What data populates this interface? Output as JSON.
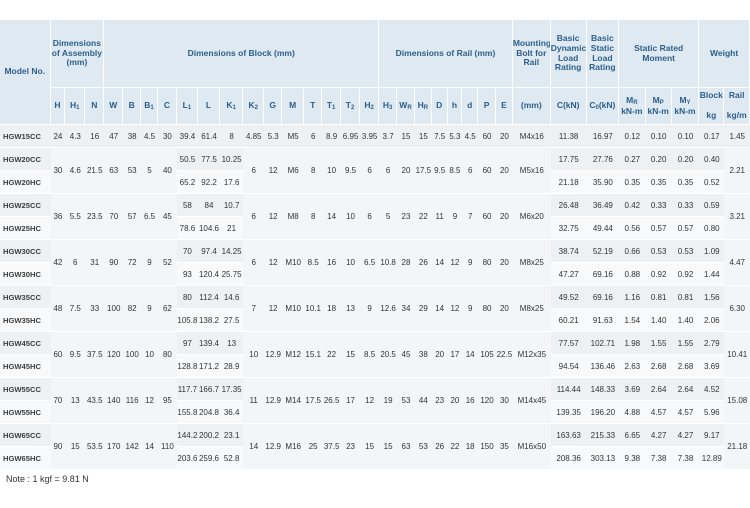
{
  "header": {
    "model_no": "Model No.",
    "dim_assembly": "Dimensions of Assembly (mm)",
    "dim_block": "Dimensions of Block (mm)",
    "dim_rail": "Dimensions of Rail (mm)",
    "mounting_bolt": "Mounting Bolt for Rail",
    "basic_dynamic": "Basic Dynamic Load Rating",
    "basic_static": "Basic Static Load Rating",
    "static_moment": "Static Rated Moment",
    "weight": "Weight",
    "block": "Block",
    "rail": "Rail",
    "sub": {
      "H": "H",
      "H1": "H₁",
      "N": "N",
      "W": "W",
      "B": "B",
      "B1": "B₁",
      "C": "C",
      "L1": "L₁",
      "L": "L",
      "K1": "K₁",
      "K2": "K₂",
      "G": "G",
      "M": "M",
      "T": "T",
      "T1": "T₁",
      "T2": "T₂",
      "H2": "H₂",
      "H3": "H₃",
      "WR": "W_R",
      "HR": "H_R",
      "D": "D",
      "h": "h",
      "d": "d",
      "P": "P",
      "E": "E",
      "mm": "(mm)",
      "C_kN": "C(kN)",
      "C0_kN": "C₀(kN)",
      "MR": "M_R",
      "MP": "M_P",
      "MY": "M_Y",
      "kNm1": "kN-m",
      "kNm2": "kN-m",
      "kNm3": "kN-m",
      "kg": "kg",
      "kgm": "kg/m"
    }
  },
  "groups": [
    {
      "rows": [
        {
          "model": "HGW15CC",
          "L1": "39.4",
          "L": "61.4",
          "K1": "8",
          "K2": "4.85",
          "C_kN": "11.38",
          "C0_kN": "16.97",
          "MR": "0.12",
          "MP": "0.10",
          "MY": "0.10",
          "kg": "0.17"
        }
      ],
      "shared": {
        "H": "24",
        "H1": "4.3",
        "N": "16",
        "W": "47",
        "B": "38",
        "B1": "4.5",
        "C": "30",
        "G": "5.3",
        "M": "M5",
        "T": "6",
        "T1": "8.9",
        "T2": "6.95",
        "H2": "3.95",
        "H3": "3.7",
        "WR": "15",
        "HR": "15",
        "D": "7.5",
        "h": "5.3",
        "d": "4.5",
        "P": "60",
        "E": "20",
        "bolt": "M4x16",
        "kgm": "1.45"
      }
    },
    {
      "rows": [
        {
          "model": "HGW20CC",
          "L1": "50.5",
          "L": "77.5",
          "K1": "10.25",
          "C_kN": "17.75",
          "C0_kN": "27.76",
          "MR": "0.27",
          "MP": "0.20",
          "MY": "0.20",
          "kg": "0.40"
        },
        {
          "model": "HGW20HC",
          "L1": "65.2",
          "L": "92.2",
          "K1": "17.6",
          "C_kN": "21.18",
          "C0_kN": "35.90",
          "MR": "0.35",
          "MP": "0.35",
          "MY": "0.35",
          "kg": "0.52"
        }
      ],
      "shared": {
        "H": "30",
        "H1": "4.6",
        "N": "21.5",
        "W": "63",
        "B": "53",
        "B1": "5",
        "C": "40",
        "K2": "6",
        "G": "12",
        "M": "M6",
        "T": "8",
        "T1": "10",
        "T2": "9.5",
        "H2": "6",
        "H3": "6",
        "WR": "20",
        "HR": "17.5",
        "D": "9.5",
        "h": "8.5",
        "d": "6",
        "P": "60",
        "E": "20",
        "bolt": "M5x16",
        "kgm": "2.21"
      }
    },
    {
      "rows": [
        {
          "model": "HGW25CC",
          "L1": "58",
          "L": "84",
          "K1": "10.7",
          "C_kN": "26.48",
          "C0_kN": "36.49",
          "MR": "0.42",
          "MP": "0.33",
          "MY": "0.33",
          "kg": "0.59"
        },
        {
          "model": "HGW25HC",
          "L1": "78.6",
          "L": "104.6",
          "K1": "21",
          "C_kN": "32.75",
          "C0_kN": "49.44",
          "MR": "0.56",
          "MP": "0.57",
          "MY": "0.57",
          "kg": "0.80"
        }
      ],
      "shared": {
        "H": "36",
        "H1": "5.5",
        "N": "23.5",
        "W": "70",
        "B": "57",
        "B1": "6.5",
        "C": "45",
        "K2": "6",
        "G": "12",
        "M": "M8",
        "T": "8",
        "T1": "14",
        "T2": "10",
        "H2": "6",
        "H3": "5",
        "WR": "23",
        "HR": "22",
        "D": "11",
        "h": "9",
        "d": "7",
        "P": "60",
        "E": "20",
        "bolt": "M6x20",
        "kgm": "3.21"
      }
    },
    {
      "rows": [
        {
          "model": "HGW30CC",
          "L1": "70",
          "L": "97.4",
          "K1": "14.25",
          "C_kN": "38.74",
          "C0_kN": "52.19",
          "MR": "0.66",
          "MP": "0.53",
          "MY": "0.53",
          "kg": "1.09"
        },
        {
          "model": "HGW30HC",
          "L1": "93",
          "L": "120.4",
          "K1": "25.75",
          "C_kN": "47.27",
          "C0_kN": "69.16",
          "MR": "0.88",
          "MP": "0.92",
          "MY": "0.92",
          "kg": "1.44"
        }
      ],
      "shared": {
        "H": "42",
        "H1": "6",
        "N": "31",
        "W": "90",
        "B": "72",
        "B1": "9",
        "C": "52",
        "K2": "6",
        "G": "12",
        "M": "M10",
        "T": "8.5",
        "T1": "16",
        "T2": "10",
        "H2": "6.5",
        "H3": "10.8",
        "WR": "28",
        "HR": "26",
        "D": "14",
        "h": "12",
        "d": "9",
        "P": "80",
        "E": "20",
        "bolt": "M8x25",
        "kgm": "4.47"
      }
    },
    {
      "rows": [
        {
          "model": "HGW35CC",
          "L1": "80",
          "L": "112.4",
          "K1": "14.6",
          "C_kN": "49.52",
          "C0_kN": "69.16",
          "MR": "1.16",
          "MP": "0.81",
          "MY": "0.81",
          "kg": "1.56"
        },
        {
          "model": "HGW35HC",
          "L1": "105.8",
          "L": "138.2",
          "K1": "27.5",
          "C_kN": "60.21",
          "C0_kN": "91.63",
          "MR": "1.54",
          "MP": "1.40",
          "MY": "1.40",
          "kg": "2.06"
        }
      ],
      "shared": {
        "H": "48",
        "H1": "7.5",
        "N": "33",
        "W": "100",
        "B": "82",
        "B1": "9",
        "C": "62",
        "K2": "7",
        "G": "12",
        "M": "M10",
        "T": "10.1",
        "T1": "18",
        "T2": "13",
        "H2": "9",
        "H3": "12.6",
        "WR": "34",
        "HR": "29",
        "D": "14",
        "h": "12",
        "d": "9",
        "P": "80",
        "E": "20",
        "bolt": "M8x25",
        "kgm": "6.30"
      }
    },
    {
      "rows": [
        {
          "model": "HGW45CC",
          "L1": "97",
          "L": "139.4",
          "K1": "13",
          "C_kN": "77.57",
          "C0_kN": "102.71",
          "MR": "1.98",
          "MP": "1.55",
          "MY": "1.55",
          "kg": "2.79"
        },
        {
          "model": "HGW45HC",
          "L1": "128.8",
          "L": "171.2",
          "K1": "28.9",
          "C_kN": "94.54",
          "C0_kN": "136.46",
          "MR": "2.63",
          "MP": "2.68",
          "MY": "2.68",
          "kg": "3.69"
        }
      ],
      "shared": {
        "H": "60",
        "H1": "9.5",
        "N": "37.5",
        "W": "120",
        "B": "100",
        "B1": "10",
        "C": "80",
        "K2": "10",
        "G": "12.9",
        "M": "M12",
        "T": "15.1",
        "T1": "22",
        "T2": "15",
        "H2": "8.5",
        "H3": "20.5",
        "WR": "45",
        "HR": "38",
        "D": "20",
        "h": "17",
        "d": "14",
        "P": "105",
        "E": "22.5",
        "bolt": "M12x35",
        "kgm": "10.41"
      }
    },
    {
      "rows": [
        {
          "model": "HGW55CC",
          "L1": "117.7",
          "L": "166.7",
          "K1": "17.35",
          "C_kN": "114.44",
          "C0_kN": "148.33",
          "MR": "3.69",
          "MP": "2.64",
          "MY": "2.64",
          "kg": "4.52"
        },
        {
          "model": "HGW55HC",
          "L1": "155.8",
          "L": "204.8",
          "K1": "36.4",
          "C_kN": "139.35",
          "C0_kN": "196.20",
          "MR": "4.88",
          "MP": "4.57",
          "MY": "4.57",
          "kg": "5.96"
        }
      ],
      "shared": {
        "H": "70",
        "H1": "13",
        "N": "43.5",
        "W": "140",
        "B": "116",
        "B1": "12",
        "C": "95",
        "K2": "11",
        "G": "12.9",
        "M": "M14",
        "T": "17.5",
        "T1": "26.5",
        "T2": "17",
        "H2": "12",
        "H3": "19",
        "WR": "53",
        "HR": "44",
        "D": "23",
        "h": "20",
        "d": "16",
        "P": "120",
        "E": "30",
        "bolt": "M14x45",
        "kgm": "15.08"
      }
    },
    {
      "rows": [
        {
          "model": "HGW65CC",
          "L1": "144.2",
          "L": "200.2",
          "K1": "23.1",
          "C_kN": "163.63",
          "C0_kN": "215.33",
          "MR": "6.65",
          "MP": "4.27",
          "MY": "4.27",
          "kg": "9.17"
        },
        {
          "model": "HGW65HC",
          "L1": "203.6",
          "L": "259.6",
          "K1": "52.8",
          "C_kN": "208.36",
          "C0_kN": "303.13",
          "MR": "9.38",
          "MP": "7.38",
          "MY": "7.38",
          "kg": "12.89"
        }
      ],
      "shared": {
        "H": "90",
        "H1": "15",
        "N": "53.5",
        "W": "170",
        "B": "142",
        "B1": "14",
        "C": "110",
        "K2": "14",
        "G": "12.9",
        "M": "M16",
        "T": "25",
        "T1": "37.5",
        "T2": "23",
        "H2": "15",
        "H3": "15",
        "WR": "63",
        "HR": "53",
        "D": "26",
        "h": "22",
        "d": "18",
        "P": "150",
        "E": "35",
        "bolt": "M16x50",
        "kgm": "21.18"
      }
    }
  ],
  "note": "Note : 1 kgf = 9.81 N"
}
